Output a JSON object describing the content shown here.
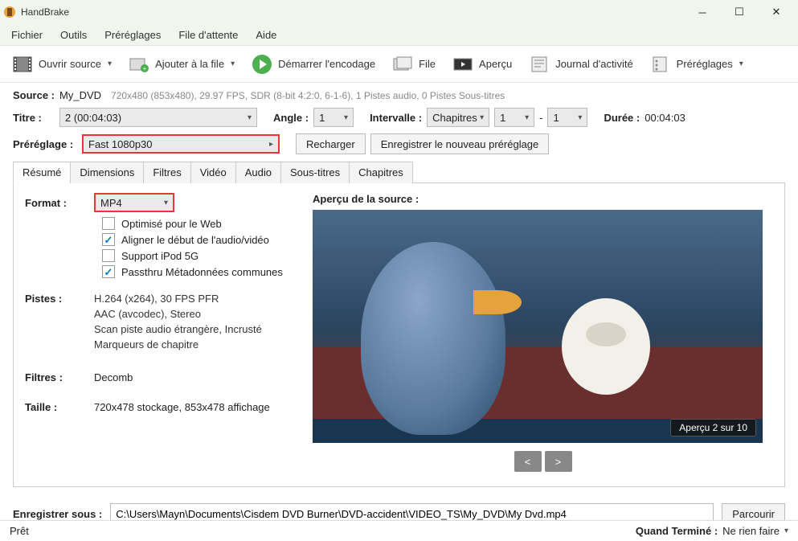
{
  "titlebar": {
    "title": "HandBrake"
  },
  "menubar": [
    "Fichier",
    "Outils",
    "Préréglages",
    "File d'attente",
    "Aide"
  ],
  "toolbar": {
    "open": "Ouvrir source",
    "queue": "Ajouter à la file",
    "start": "Démarrer l'encodage",
    "file": "File",
    "preview": "Aperçu",
    "log": "Journal d'activité",
    "presets": "Préréglages"
  },
  "source": {
    "label": "Source :",
    "name": "My_DVD",
    "info": "720x480 (853x480), 29.97 FPS, SDR (8-bit 4:2:0, 6-1-6), 1 Pistes audio, 0 Pistes Sous-titres"
  },
  "title": {
    "label": "Titre :",
    "value": "2  (00:04:03)"
  },
  "angle": {
    "label": "Angle :",
    "value": "1"
  },
  "interval": {
    "label": "Intervalle :",
    "type": "Chapitres",
    "from": "1",
    "dash": "-",
    "to": "1"
  },
  "duration": {
    "label": "Durée :",
    "value": "00:04:03"
  },
  "preset": {
    "label": "Préréglage :",
    "value": "Fast 1080p30",
    "reload": "Recharger",
    "save": "Enregistrer le nouveau préréglage"
  },
  "tabs": [
    "Résumé",
    "Dimensions",
    "Filtres",
    "Vidéo",
    "Audio",
    "Sous-titres",
    "Chapitres"
  ],
  "summary": {
    "format_label": "Format :",
    "format_value": "MP4",
    "checks": [
      {
        "label": "Optimisé pour le Web",
        "checked": false
      },
      {
        "label": "Aligner le début de l'audio/vidéo",
        "checked": true
      },
      {
        "label": "Support iPod 5G",
        "checked": false
      },
      {
        "label": "Passthru Métadonnées communes",
        "checked": true
      }
    ],
    "tracks_label": "Pistes :",
    "tracks": [
      "H.264 (x264), 30 FPS PFR",
      "AAC (avcodec), Stereo",
      "Scan piste audio étrangère, Incrusté",
      "Marqueurs de chapitre"
    ],
    "filters_label": "Filtres :",
    "filters_value": "Decomb",
    "size_label": "Taille :",
    "size_value": "720x478 stockage, 853x478 affichage"
  },
  "preview": {
    "title": "Aperçu de la source :",
    "badge": "Aperçu 2 sur 10",
    "prev": "<",
    "next": ">"
  },
  "save": {
    "label": "Enregistrer sous :",
    "path": "C:\\Users\\Mayn\\Documents\\Cisdem DVD Burner\\DVD-accident\\VIDEO_TS\\My_DVD\\My Dvd.mp4",
    "browse": "Parcourir"
  },
  "status": {
    "ready": "Prêt",
    "done_label": "Quand Terminé :",
    "done_value": "Ne rien faire"
  }
}
